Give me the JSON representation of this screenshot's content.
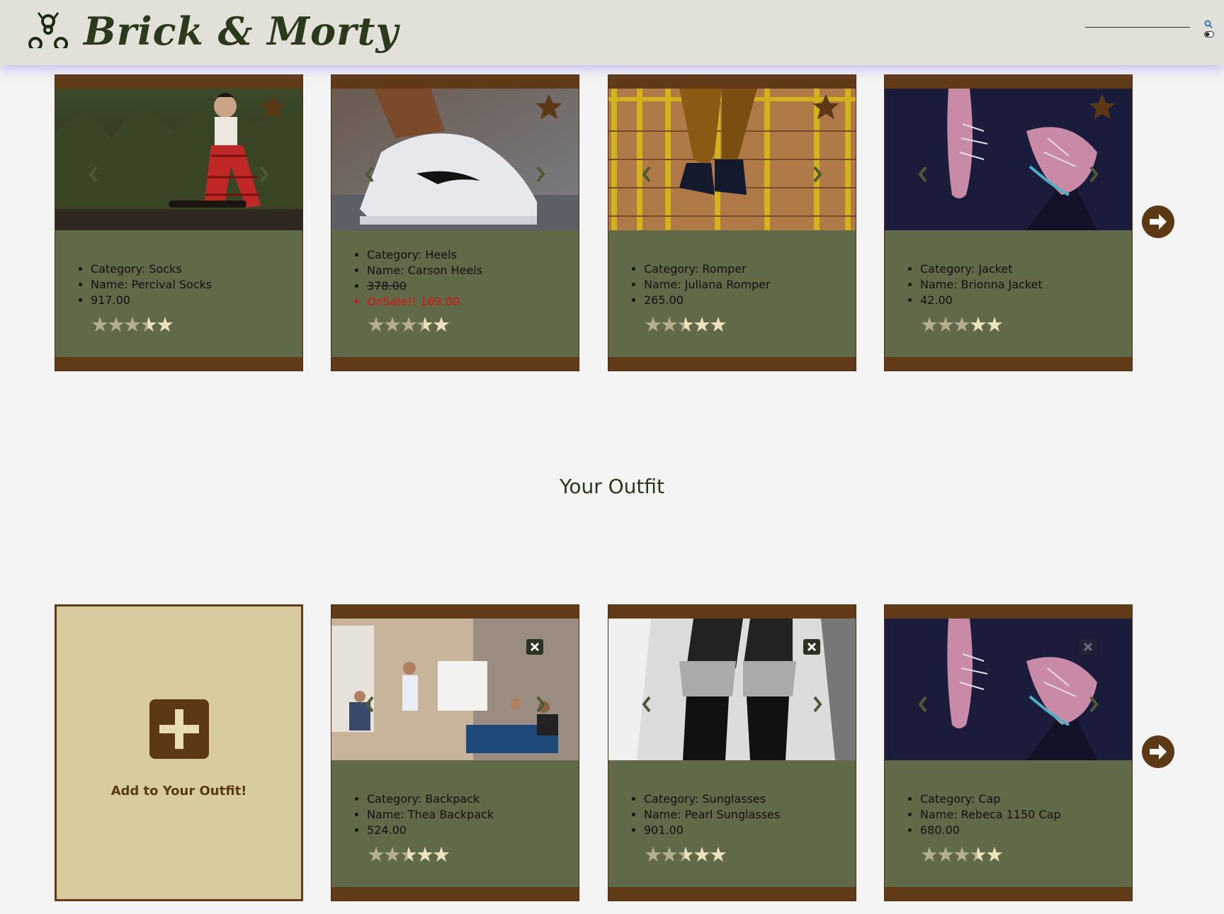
{
  "header": {
    "brand": "Brick & Morty",
    "logo_icon": "biohazard-icon",
    "search_placeholder": "",
    "search_icon": "search-icon",
    "toggle_icon": "theme-toggle-icon"
  },
  "colors": {
    "header_bg": "#e1e1da",
    "card_frame": "#613b18",
    "card_body": "#616a48",
    "star_filled": "#b4b08f",
    "star_empty": "#ece3bc",
    "sale_text": "#e01010",
    "add_card_bg": "#d8cc9f"
  },
  "related": {
    "cards": [
      {
        "category": "Category: Socks",
        "name": "Name: Percival Socks",
        "price": "917.00",
        "sale": "",
        "rating": 3.5,
        "image": "person-sitting-on-skateboard"
      },
      {
        "category": "Category: Heels",
        "name": "Name: Carson Heels",
        "price": "378.00",
        "sale": "OnSale!! 169.00",
        "rating": 3.5,
        "image": "white-sneaker-closeup"
      },
      {
        "category": "Category: Romper",
        "name": "Name: Juliana Romper",
        "price": "265.00",
        "sale": "",
        "rating": 2.5,
        "image": "legs-with-converse-sneakers"
      },
      {
        "category": "Category: Jacket",
        "name": "Name: Brionna Jacket",
        "price": "42.00",
        "sale": "",
        "rating": 3,
        "image": "pink-knit-sneakers"
      }
    ],
    "next_icon": "arrow-circle-right-icon"
  },
  "outfit": {
    "title": "Your Outfit",
    "add_label": "Add to Your Outfit!",
    "add_icon": "plus-square-icon",
    "cards": [
      {
        "category": "Category: Backpack",
        "name": "Name: Thea Backpack",
        "price": "524.00",
        "rating": 2.5,
        "image": "office-team-meeting"
      },
      {
        "category": "Category: Sunglasses",
        "name": "Name: Pearl Sunglasses",
        "price": "901.00",
        "rating": 2.5,
        "image": "black-white-sneakers"
      },
      {
        "category": "Category: Cap",
        "name": "Name: Rebeca 1150 Cap",
        "price": "680.00",
        "rating": 3.5,
        "image": "pink-knit-sneakers"
      }
    ],
    "next_icon": "arrow-circle-right-icon"
  }
}
